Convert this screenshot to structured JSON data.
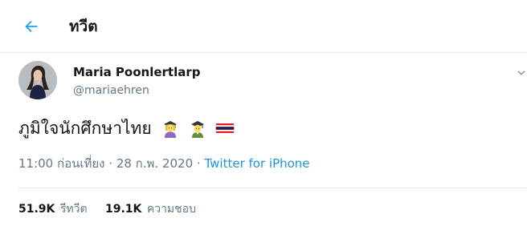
{
  "header": {
    "title": "ทวีต",
    "back_icon": "arrow-left-icon"
  },
  "colors": {
    "accent": "#1da1f2",
    "link": "#1b95e0",
    "text": "#14171a",
    "secondary": "#657786",
    "border": "#e6ecf0"
  },
  "tweet": {
    "author_name": "Maria Poonlertlarp",
    "author_handle": "@mariaehren",
    "text": "ภูมิใจนักศึกษาไทย",
    "emojis": [
      "woman-student-icon",
      "man-student-icon",
      "thailand-flag-icon"
    ],
    "time": "11:00 ก่อนเที่ยง",
    "date": "28 ก.พ. 2020",
    "source": "Twitter for iPhone",
    "separator": "·",
    "retweets_count": "51.9K",
    "retweets_label": "รีทวีต",
    "likes_count": "19.1K",
    "likes_label": "ความชอบ"
  }
}
